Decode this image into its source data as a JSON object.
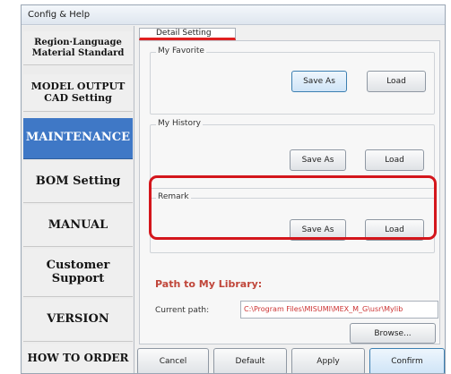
{
  "window": {
    "title": "Config & Help"
  },
  "sidebar": {
    "items": [
      {
        "lines": [
          "Region·Language",
          "Material Standard"
        ]
      },
      {
        "lines": [
          "MODEL OUTPUT",
          "CAD Setting"
        ]
      },
      {
        "lines": [
          "MAINTENANCE"
        ],
        "active": true
      },
      {
        "lines": [
          "BOM Setting"
        ]
      },
      {
        "lines": [
          "MANUAL"
        ]
      },
      {
        "lines": [
          "Customer",
          "Support"
        ]
      },
      {
        "lines": [
          "VERSION"
        ]
      },
      {
        "lines": [
          "HOW TO ORDER"
        ]
      }
    ]
  },
  "panel": {
    "tab_label": "Detail Setting",
    "groups": {
      "favorite": {
        "title": "My Favorite",
        "save_label": "Save As",
        "load_label": "Load"
      },
      "history": {
        "title": "My History",
        "save_label": "Save As",
        "load_label": "Load"
      },
      "remark": {
        "title": "Remark",
        "save_label": "Save As",
        "load_label": "Load"
      }
    },
    "library": {
      "heading": "Path to My Library:",
      "current_path_label": "Current path:",
      "current_path_value": "C:\\Program Files\\MISUMI\\MEX_M_G\\usr\\Mylib",
      "browse_label": "Browse..."
    }
  },
  "footer": {
    "cancel_label": "Cancel",
    "default_label": "Default",
    "apply_label": "Apply",
    "confirm_label": "Confirm"
  },
  "colors": {
    "active_sidebar": "#3f78c6",
    "tab_underline": "#e02020",
    "highlight_frame": "#d4161c",
    "path_heading": "#c0463a"
  }
}
